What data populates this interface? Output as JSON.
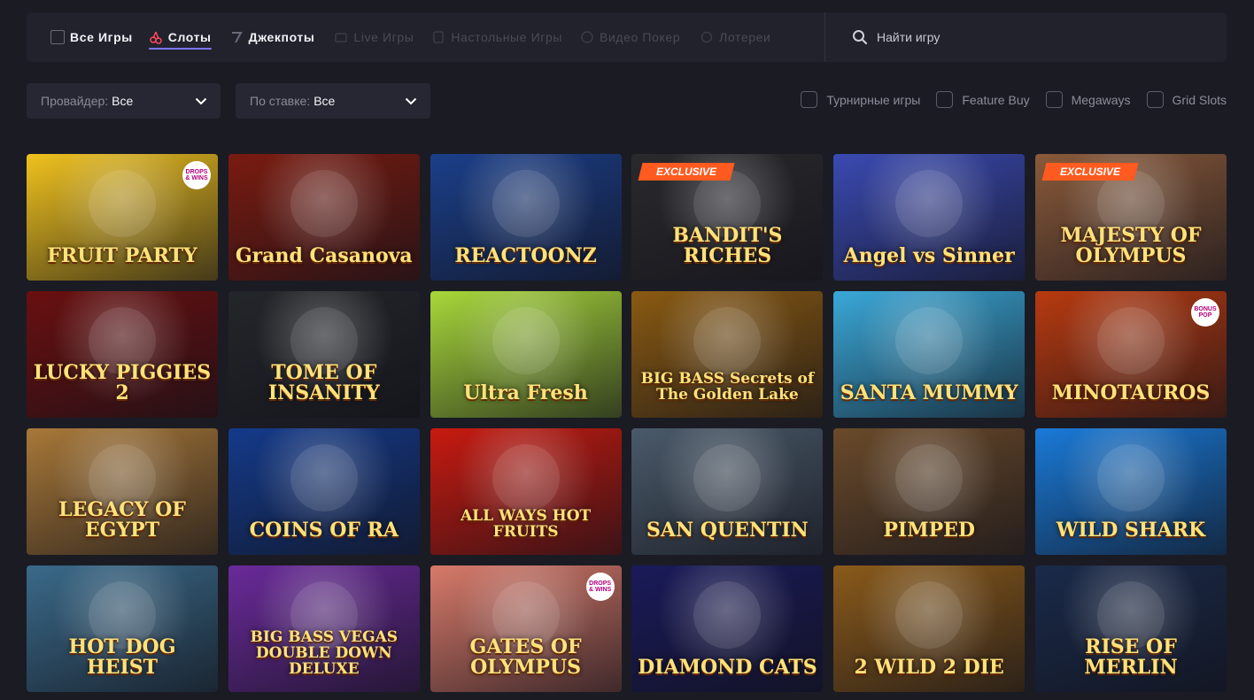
{
  "nav": {
    "tabs": [
      {
        "label": "Все Игры",
        "icon": "all-games-icon"
      },
      {
        "label": "Слоты",
        "icon": "cherry-icon"
      },
      {
        "label": "Джекпоты",
        "icon": "seven-icon"
      },
      {
        "label": "Live Игры",
        "icon": "live-icon"
      },
      {
        "label": "Настольные Игры",
        "icon": "table-games-icon"
      },
      {
        "label": "Видео Покер",
        "icon": "poker-chip-icon"
      },
      {
        "label": "Лотереи",
        "icon": "lottery-icon"
      }
    ],
    "active_tab": "Слоты",
    "search_placeholder": "Найти игру"
  },
  "filters": {
    "provider_label": "Провайдер:",
    "provider_value": "Все",
    "bet_label": "По ставке:",
    "bet_value": "Все",
    "checkboxes": [
      "Турнирные игры",
      "Feature Buy",
      "Megaways",
      "Grid Slots"
    ]
  },
  "games": [
    {
      "title": "FRUIT PARTY",
      "badge_round": "DROPS & WINS",
      "bg": "#f0c21e"
    },
    {
      "title": "Grand Casanova",
      "bg": "#7a1b10"
    },
    {
      "title": "REACTOONZ",
      "bg": "#1b3f8a"
    },
    {
      "title": "BANDIT'S RICHES",
      "badge": "EXCLUSIVE",
      "bg": "#2a2a2e"
    },
    {
      "title": "Angel vs Sinner",
      "bg": "#3a4ab2"
    },
    {
      "title": "MAJESTY OF OLYMPUS",
      "badge": "EXCLUSIVE",
      "bg": "#8a5a3a"
    },
    {
      "title": "LUCKY PIGGIES 2",
      "bg": "#6a1010"
    },
    {
      "title": "TOME OF INSANITY",
      "bg": "#23262a"
    },
    {
      "title": "Ultra Fresh",
      "bg": "#a8d83a"
    },
    {
      "title": "BIG BASS Secrets of The Golden Lake",
      "bg": "#8a5a12"
    },
    {
      "title": "SANTA MUMMY",
      "bg": "#3aa8d8"
    },
    {
      "title": "MINOTAUROS",
      "badge_round": "BONUS POP",
      "bg": "#b83a10"
    },
    {
      "title": "LEGACY OF EGYPT",
      "bg": "#a87838"
    },
    {
      "title": "COINS OF RA",
      "bg": "#143a8a"
    },
    {
      "title": "ALL WAYS HOT FRUITS",
      "bg": "#c81a10"
    },
    {
      "title": "SAN QUENTIN",
      "bg": "#4a5a6a"
    },
    {
      "title": "PIMPED",
      "bg": "#6a4a2a"
    },
    {
      "title": "WILD SHARK",
      "bg": "#1a7ad8"
    },
    {
      "title": "HOT DOG HEIST",
      "bg": "#3a6a8a"
    },
    {
      "title": "BIG BASS VEGAS DOUBLE DOWN DELUXE",
      "bg": "#6a2a9a"
    },
    {
      "title": "GATES OF OLYMPUS",
      "badge_round": "DROPS & WINS",
      "bg": "#d87a6a"
    },
    {
      "title": "DIAMOND CATS",
      "bg": "#1a1a5a"
    },
    {
      "title": "2 WILD 2 DIE",
      "bg": "#8a5a1a"
    },
    {
      "title": "RISE OF MERLIN",
      "bg": "#1a2a4a"
    }
  ]
}
